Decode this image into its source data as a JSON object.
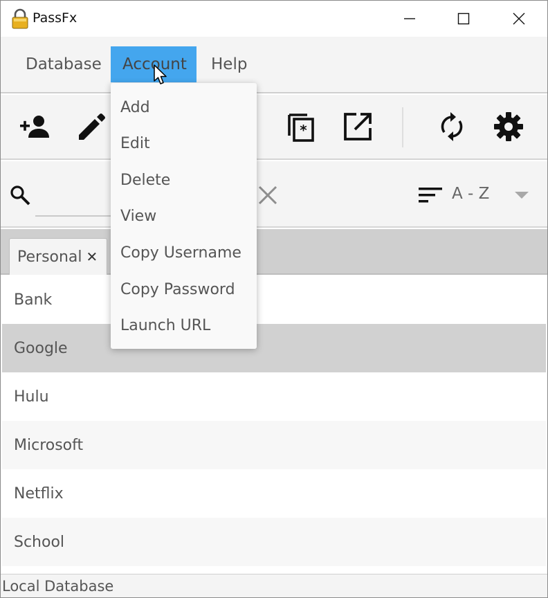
{
  "window": {
    "title": "PassFx",
    "controls": [
      "minimize",
      "maximize",
      "close"
    ]
  },
  "menubar": {
    "items": [
      {
        "label": "Database",
        "active": false
      },
      {
        "label": "Account",
        "active": true
      },
      {
        "label": "Help",
        "active": false
      }
    ]
  },
  "toolbar": {
    "buttons": [
      {
        "icon": "add-person-icon",
        "enabled": true
      },
      {
        "icon": "edit-pencil-icon",
        "enabled": true
      },
      {
        "icon": "delete-trash-icon",
        "enabled": false
      },
      {
        "icon": "copy-icon",
        "enabled": false
      },
      {
        "icon": "copy-password-icon",
        "enabled": true
      },
      {
        "icon": "launch-url-icon",
        "enabled": true
      },
      {
        "icon": "sync-icon",
        "enabled": true
      },
      {
        "icon": "settings-gear-icon",
        "enabled": true
      }
    ]
  },
  "search": {
    "value": "",
    "placeholder": ""
  },
  "sort": {
    "label": "A - Z"
  },
  "tabs": [
    {
      "label": "Personal",
      "close": "✕"
    }
  ],
  "accounts": [
    {
      "name": "Bank",
      "selected": false
    },
    {
      "name": "Google",
      "selected": true
    },
    {
      "name": "Hulu",
      "selected": false
    },
    {
      "name": "Microsoft",
      "selected": false
    },
    {
      "name": "Netflix",
      "selected": false
    },
    {
      "name": "School",
      "selected": false
    }
  ],
  "status": {
    "text": "Local Database"
  },
  "account_menu": {
    "items": [
      {
        "label": "Add"
      },
      {
        "label": "Edit"
      },
      {
        "label": "Delete"
      },
      {
        "label": "View"
      },
      {
        "label": "Copy Username"
      },
      {
        "label": "Copy Password"
      },
      {
        "label": "Launch URL"
      }
    ]
  },
  "colors": {
    "menu_highlight": "#44a6ee",
    "selected_row": "#d1d1d1",
    "lock_gold": "#e8b020"
  }
}
